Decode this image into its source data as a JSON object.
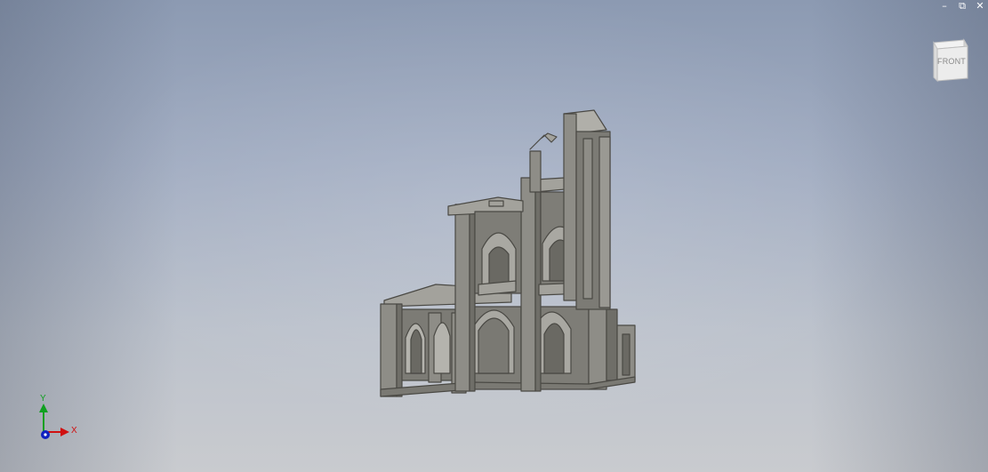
{
  "window_controls": {
    "minimize": "–",
    "restore": "⧉",
    "close": "✕"
  },
  "view_cube": {
    "face_label": "FRONT"
  },
  "axis_triad": {
    "y_label": "Y",
    "x_label": "X",
    "colors": {
      "x": "#d01010",
      "y": "#10a020",
      "z": "#1020c0"
    }
  },
  "model": {
    "icon": "gothic-ruin-model",
    "color": "#8b8a84"
  }
}
